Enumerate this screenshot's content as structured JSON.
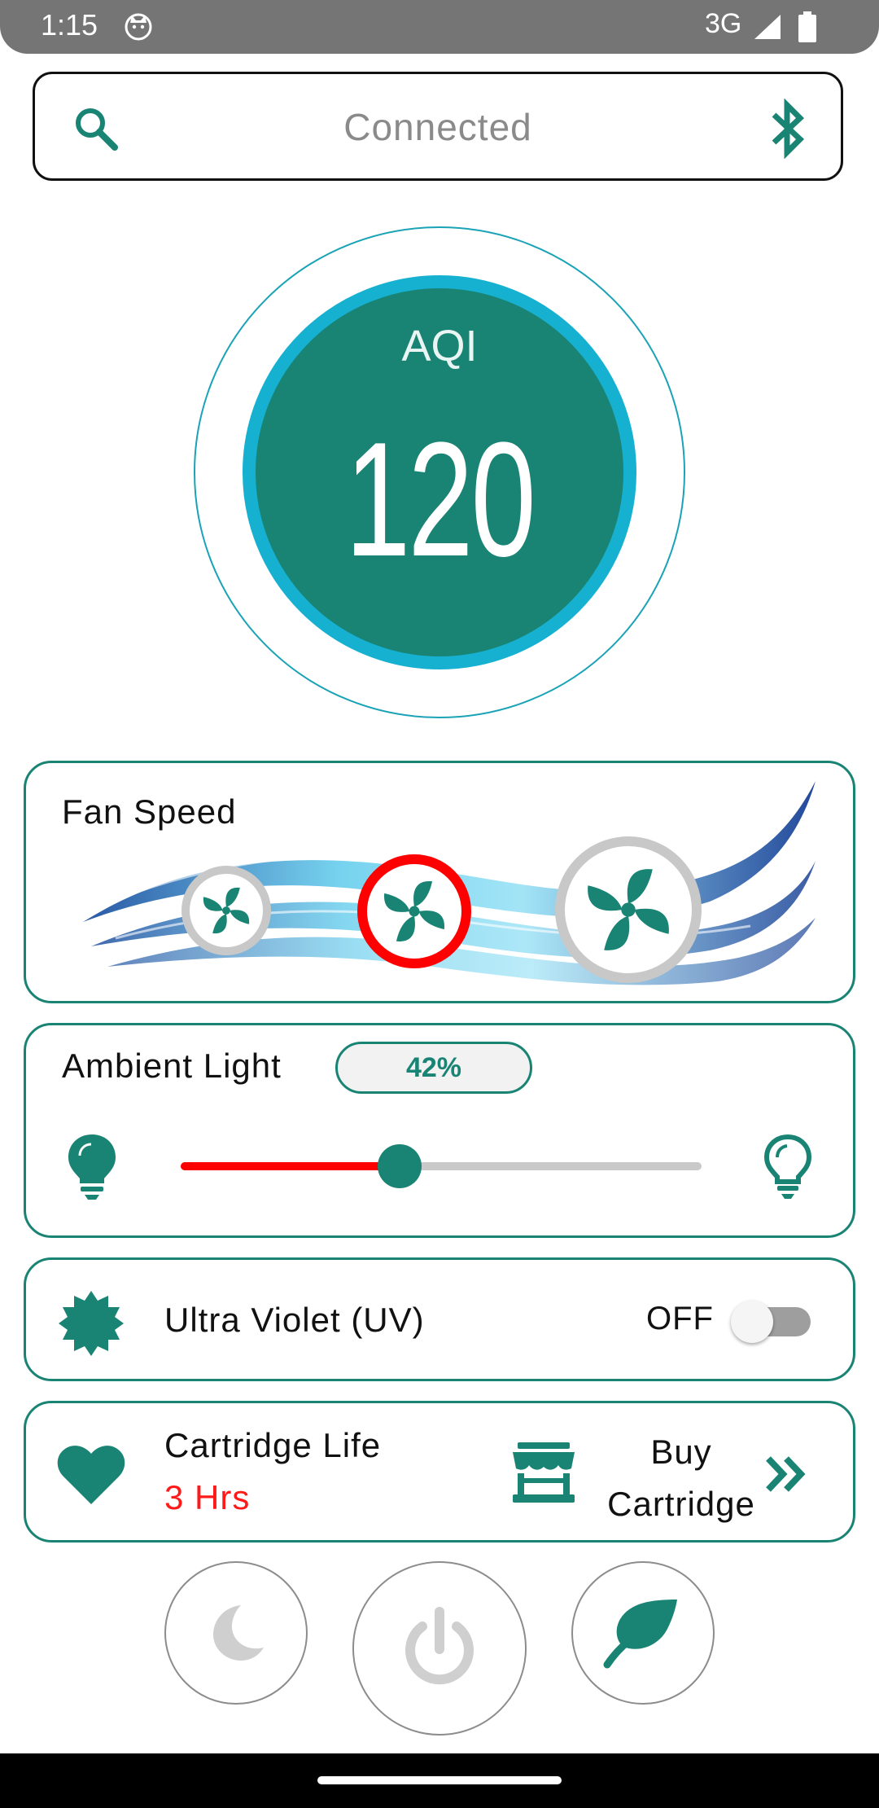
{
  "status_bar": {
    "time": "1:15",
    "network": "3G",
    "icons": [
      "cat-notification-icon",
      "signal-icon",
      "battery-icon"
    ]
  },
  "connection": {
    "status_text": "Connected",
    "icons": [
      "search-icon",
      "bluetooth-icon"
    ]
  },
  "aqi": {
    "label": "AQI",
    "value": "120"
  },
  "fan_speed": {
    "title": "Fan Speed",
    "levels": [
      "low",
      "medium",
      "high"
    ],
    "selected": "medium"
  },
  "ambient_light": {
    "title": "Ambient Light",
    "percent_label": "42%",
    "level": 0.42
  },
  "uv": {
    "label": "Ultra Violet (UV)",
    "state_label": "OFF",
    "enabled": false
  },
  "cartridge": {
    "label": "Cartridge Life",
    "value": "3 Hrs",
    "buy_line1": "Buy",
    "buy_line2": "Cartridge"
  },
  "modes": [
    "night-mode",
    "power",
    "eco-mode"
  ],
  "colors": {
    "teal": "#1a8474",
    "cyan_ring": "#16b0d0",
    "alert_red": "#ff0000",
    "grey": "#c8c8c8"
  }
}
